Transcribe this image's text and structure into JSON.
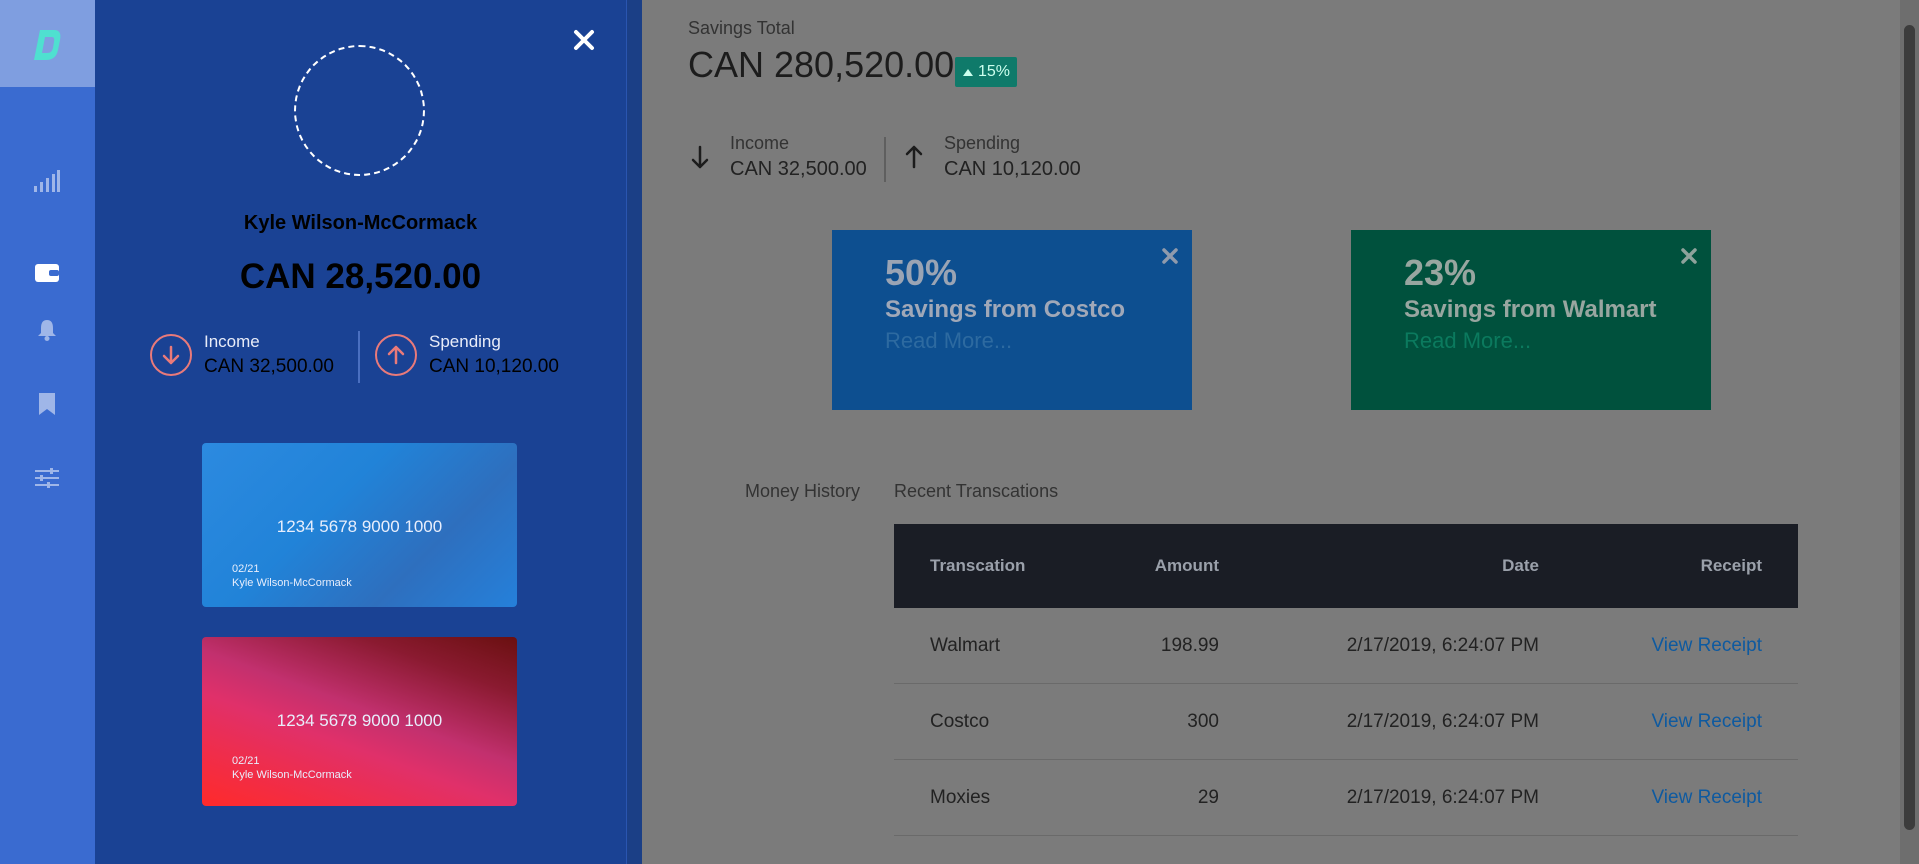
{
  "profile": {
    "name": "Kyle Wilson-McCormack",
    "balance": "CAN 28,520.00",
    "income_label": "Income",
    "income_value": "CAN 32,500.00",
    "spending_label": "Spending",
    "spending_value": "CAN 10,120.00"
  },
  "cards": [
    {
      "number": "1234 5678 9000 1000",
      "expiry": "02/21",
      "holder": "Kyle Wilson-McCormack"
    },
    {
      "number": "1234 5678 9000 1000",
      "expiry": "02/21",
      "holder": "Kyle Wilson-McCormack"
    }
  ],
  "savings": {
    "title": "Savings Total",
    "total": "CAN 280,520.00",
    "change": "15%",
    "income_label": "Income",
    "income_value": "CAN 32,500.00",
    "spending_label": "Spending",
    "spending_value": "CAN 10,120.00"
  },
  "promos": [
    {
      "percent": "50%",
      "title": "Savings from Costco",
      "more": "Read More..."
    },
    {
      "percent": "23%",
      "title": "Savings from Walmart",
      "more": "Read More..."
    }
  ],
  "tabs": [
    "Money History",
    "Recent Transcations"
  ],
  "table": {
    "headers": [
      "Transcation",
      "Amount",
      "Date",
      "Receipt"
    ],
    "rows": [
      {
        "name": "Walmart",
        "amount": "198.99",
        "date": "2/17/2019, 6:24:07 PM",
        "receipt": "View Receipt"
      },
      {
        "name": "Costco",
        "amount": "300",
        "date": "2/17/2019, 6:24:07 PM",
        "receipt": "View Receipt"
      },
      {
        "name": "Moxies",
        "amount": "29",
        "date": "2/17/2019, 6:24:07 PM",
        "receipt": "View Receipt"
      }
    ]
  },
  "colors": {
    "rail": "#3a6bd0",
    "drawer": "#1a4294",
    "badge": "#0f7a6a",
    "link": "#0e5aa0"
  }
}
